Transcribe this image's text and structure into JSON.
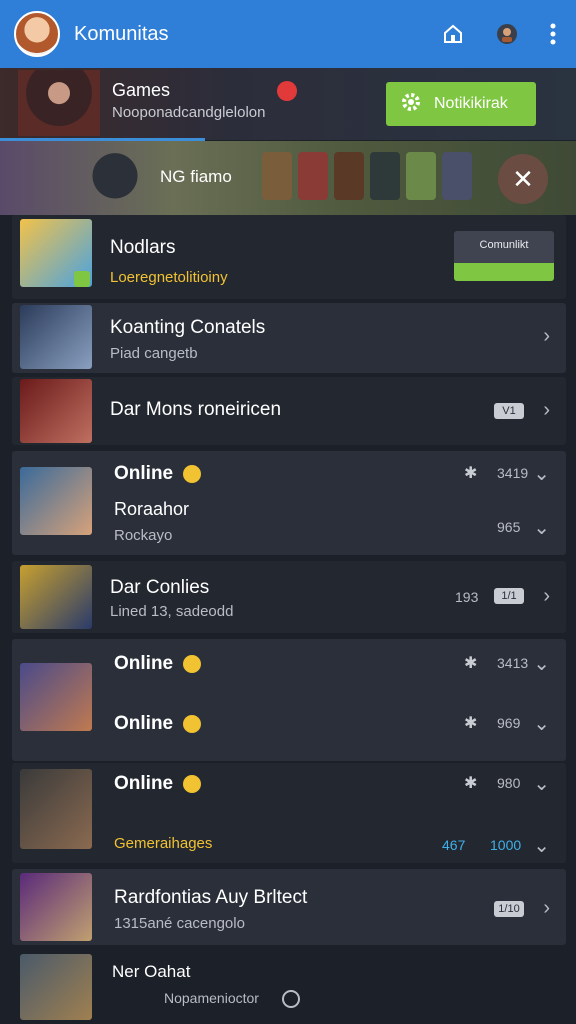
{
  "appbar": {
    "title": "Komunitas",
    "icons": [
      "home-icon",
      "profile-icon",
      "more-vert-icon"
    ]
  },
  "games": {
    "title": "Games",
    "subtitle": "Nooponadcandglelolon",
    "notify_label": "Notikikirak"
  },
  "banner": {
    "text": "NG fiamo"
  },
  "rows": [
    {
      "title": "Nodlars",
      "subtitle": "Loeregnetolitioiny",
      "button_label": "Comunlikt"
    },
    {
      "title": "Koanting Conatels",
      "subtitle": "Piad cangetb"
    },
    {
      "title": "Dar Mons roneiricen",
      "pill": "V1"
    },
    {
      "title": "Online",
      "title2": "Roraahor",
      "subtitle": "Rockayo",
      "n1": "3419",
      "n2": "965"
    },
    {
      "title": "Dar Conlies",
      "subtitle": "Lined 13, sadeodd",
      "n1": "193",
      "pill": "1/1"
    },
    {
      "title": "Online",
      "title2": "Online",
      "n1": "3413",
      "n2": "969"
    },
    {
      "title": "Online",
      "subtitle": "Gemeraihages",
      "n1": "980",
      "n2": "467",
      "n3": "1000"
    },
    {
      "title": "Rardfontias Auy Brltect",
      "subtitle": "1315ané cacengolo",
      "pill": "1/10"
    },
    {
      "title": "Ner Oahat",
      "subtitle": "Nopamenioctor"
    }
  ]
}
